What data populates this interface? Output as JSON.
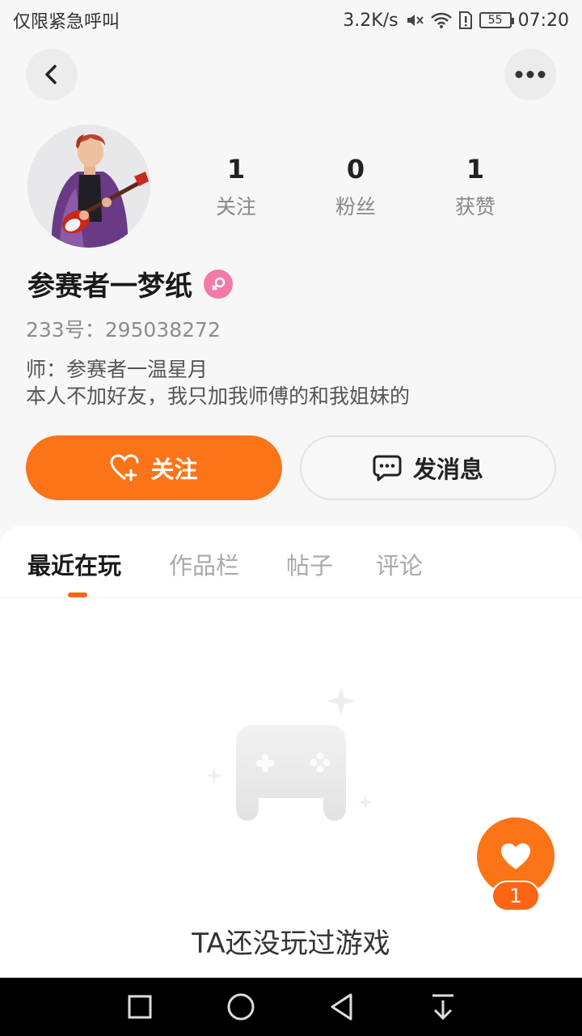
{
  "status_bar": {
    "carrier": "仅限紧急呼叫",
    "speed": "3.2K/s",
    "battery": "55",
    "time": "07:20"
  },
  "profile": {
    "stats": [
      {
        "num": "1",
        "label": "关注"
      },
      {
        "num": "0",
        "label": "粉丝"
      },
      {
        "num": "1",
        "label": "获赞"
      }
    ],
    "nickname": "参赛者一梦纸",
    "uid": "233号：295038272",
    "bio_line1": "师：参赛者一温星月",
    "bio_line2": "本人不加好友，我只加我师傅的和我姐妹的"
  },
  "actions": {
    "follow_label": "关注",
    "message_label": "发消息"
  },
  "tabs": [
    {
      "label": "最近在玩",
      "active": true
    },
    {
      "label": "作品栏",
      "active": false
    },
    {
      "label": "帖子",
      "active": false
    },
    {
      "label": "评论",
      "active": false
    }
  ],
  "empty_state": {
    "text": "TA还没玩过游戏"
  },
  "like_fab": {
    "count": "1"
  },
  "colors": {
    "accent": "#fb7418",
    "gender_badge": "#f37aa7"
  }
}
